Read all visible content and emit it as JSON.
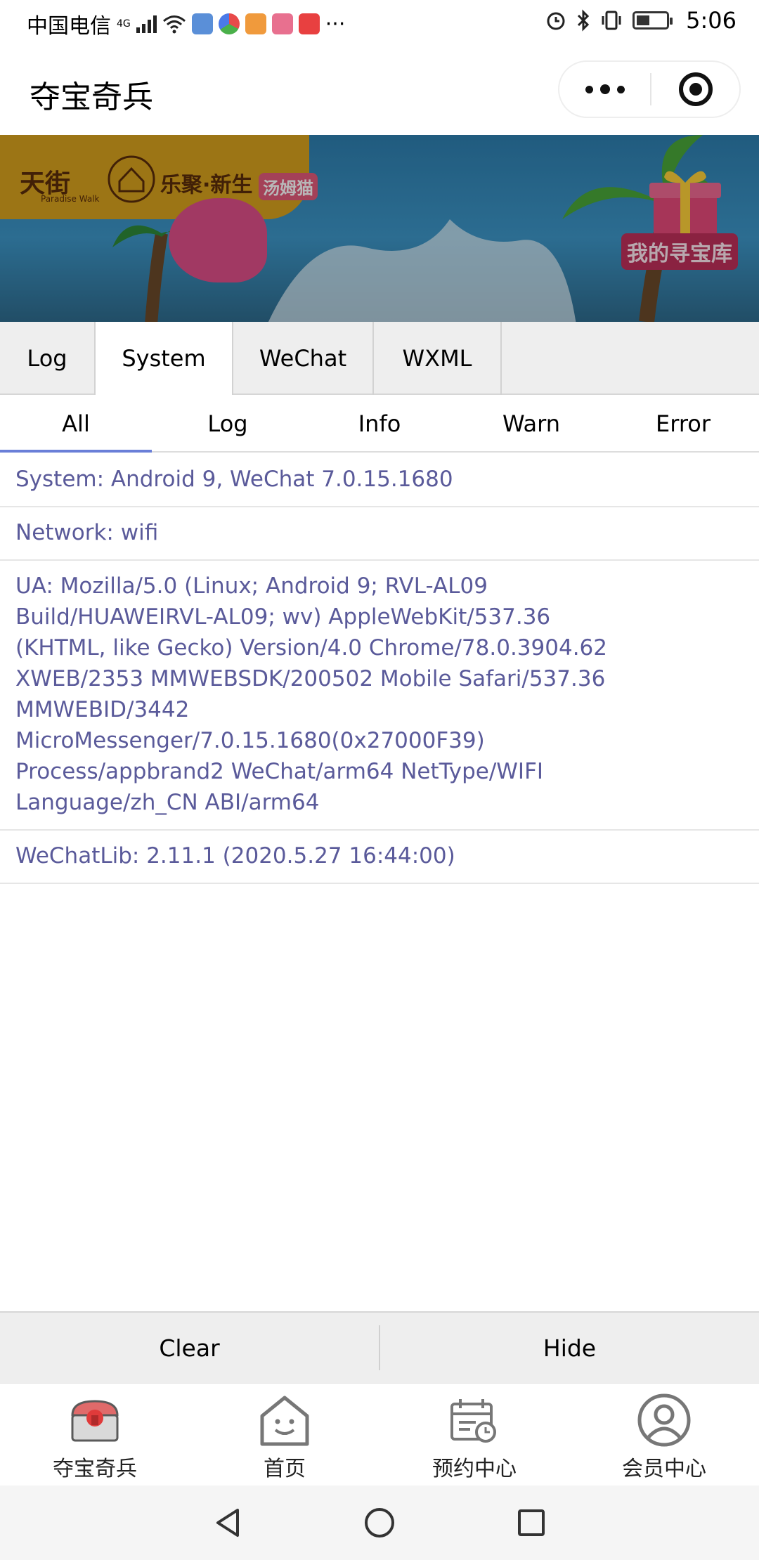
{
  "status_bar": {
    "carrier": "中国电信",
    "network_type": "4G",
    "time": "5:06",
    "notification_more": "···",
    "icons": [
      "signal-icon",
      "wifi-icon",
      "app-notification-icons",
      "alarm-icon",
      "bluetooth-icon",
      "vibrate-icon",
      "battery-icon"
    ]
  },
  "header": {
    "title": "夺宝奇兵",
    "more_icon": "more-dots-icon",
    "close_icon": "close-miniprogram-icon"
  },
  "banner": {
    "logo_1": "天街",
    "logo_1_sub": "Paradise Walk",
    "logo_2": "乐聚·新生",
    "logo_3": "汤姆猫",
    "gift_label": "我的寻宝库"
  },
  "main_tabs": [
    {
      "label": "Log",
      "active": false
    },
    {
      "label": "System",
      "active": true
    },
    {
      "label": "WeChat",
      "active": false
    },
    {
      "label": "WXML",
      "active": false
    }
  ],
  "sub_tabs": [
    {
      "label": "All",
      "active": true
    },
    {
      "label": "Log",
      "active": false
    },
    {
      "label": "Info",
      "active": false
    },
    {
      "label": "Warn",
      "active": false
    },
    {
      "label": "Error",
      "active": false
    }
  ],
  "logs": [
    "System: Android 9, WeChat 7.0.15.1680",
    "Network: wifi",
    "UA: Mozilla/5.0 (Linux; Android 9; RVL-AL09\nBuild/HUAWEIRVL-AL09; wv) AppleWebKit/537.36\n(KHTML, like Gecko) Version/4.0 Chrome/78.0.3904.62\nXWEB/2353 MMWEBSDK/200502 Mobile Safari/537.36\nMMWEBID/3442\nMicroMessenger/7.0.15.1680(0x27000F39)\nProcess/appbrand2 WeChat/arm64 NetType/WIFI\nLanguage/zh_CN ABI/arm64",
    "WeChatLib: 2.11.1 (2020.5.27 16:44:00)"
  ],
  "actions": {
    "clear": "Clear",
    "hide": "Hide"
  },
  "tabbar": [
    {
      "label": "夺宝奇兵",
      "icon": "treasure-chest-icon",
      "active": true
    },
    {
      "label": "首页",
      "icon": "home-icon",
      "active": false
    },
    {
      "label": "预约中心",
      "icon": "calendar-clock-icon",
      "active": false
    },
    {
      "label": "会员中心",
      "icon": "user-profile-icon",
      "active": false
    }
  ],
  "colors": {
    "log_text": "#5a5a9a",
    "accent_underline": "#6a7fd8",
    "tab_bg": "#eeeeee"
  }
}
